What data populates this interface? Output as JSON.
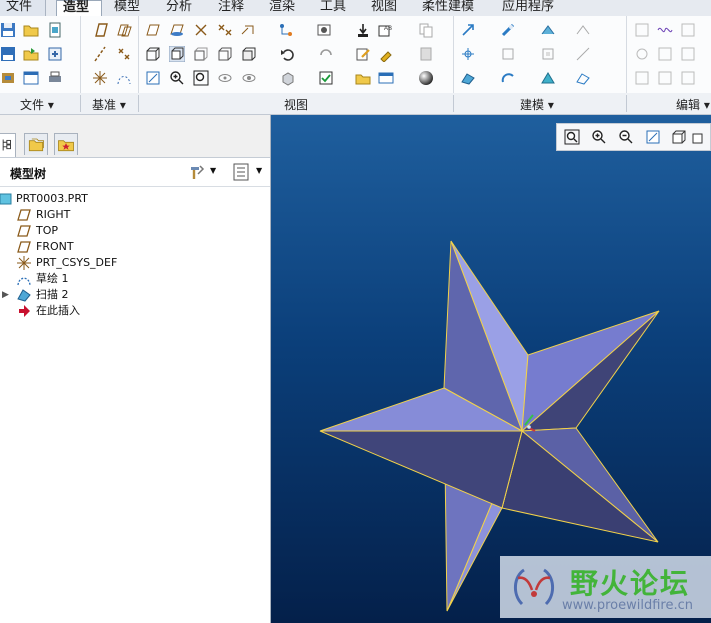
{
  "menu": {
    "tabs": [
      {
        "label": "文件 ▾"
      },
      {
        "label": "造型"
      },
      {
        "label": "模型"
      },
      {
        "label": "分析"
      },
      {
        "label": "注释"
      },
      {
        "label": "渲染"
      },
      {
        "label": "工具"
      },
      {
        "label": "视图"
      },
      {
        "label": "柔性建模"
      },
      {
        "label": "应用程序"
      }
    ],
    "active_index": 1
  },
  "ribbon": {
    "groups": [
      {
        "label": "文件 ▾"
      },
      {
        "label": "基准 ▾"
      },
      {
        "label": "视图"
      },
      {
        "label": "建模 ▾"
      },
      {
        "label": "编辑 ▾"
      }
    ]
  },
  "model_tree": {
    "title": "模型树",
    "items": [
      {
        "label": "PRT0003.PRT",
        "icon": "part-icon"
      },
      {
        "label": "RIGHT",
        "icon": "datum-plane-icon"
      },
      {
        "label": "TOP",
        "icon": "datum-plane-icon"
      },
      {
        "label": "FRONT",
        "icon": "datum-plane-icon"
      },
      {
        "label": "PRT_CSYS_DEF",
        "icon": "csys-icon"
      },
      {
        "label": "草绘 1",
        "icon": "sketch-icon"
      },
      {
        "label": "扫描 2",
        "icon": "sweep-icon"
      },
      {
        "label": "在此插入",
        "icon": "insert-here-arrow-icon"
      }
    ]
  },
  "viewport": {
    "model": "five-point star",
    "star_colors": {
      "light": "#7f86d6",
      "mid": "#5f66ad",
      "dark": "#3f4477",
      "edge": "#f2d24a"
    }
  },
  "watermark": {
    "title": "野火论坛",
    "url": "www.proewildfire.cn"
  },
  "colors": {
    "accent": "#2a6db5",
    "viewport_top": "#1f5f9e",
    "viewport_bottom": "#04204a"
  }
}
